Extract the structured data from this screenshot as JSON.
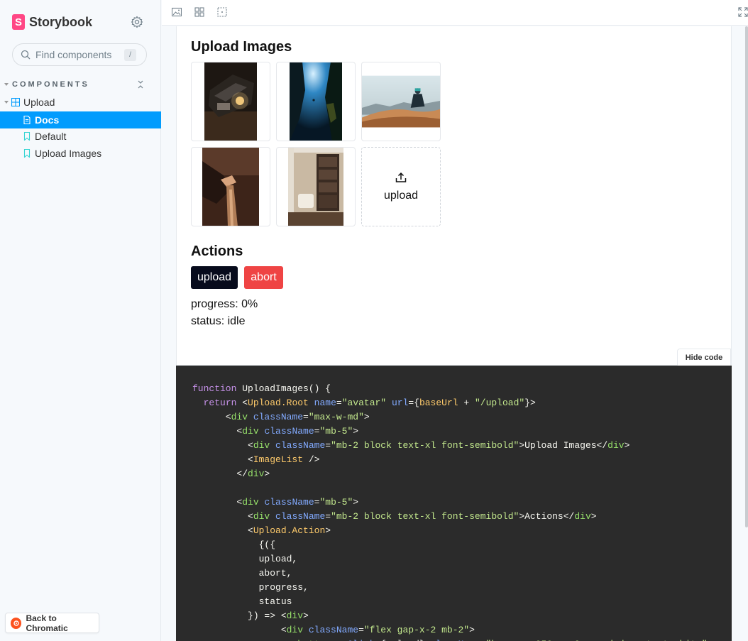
{
  "sidebar": {
    "brand": "Storybook",
    "logo_letter": "S",
    "search_placeholder": "Find components",
    "search_shortcut": "/",
    "section": "COMPONENTS",
    "tree": [
      {
        "label": "Upload",
        "type": "component"
      },
      {
        "label": "Docs",
        "type": "docs",
        "active": true
      },
      {
        "label": "Default",
        "type": "story"
      },
      {
        "label": "Upload Images",
        "type": "story"
      }
    ],
    "back_label": "Back to Chromatic"
  },
  "toolbar": {
    "icons": [
      "image-icon",
      "grid-icon",
      "outline-icon"
    ],
    "fullscreen_icon": "fullscreen-icon"
  },
  "story": {
    "images_title": "Upload Images",
    "upload_tile_label": "upload",
    "actions_title": "Actions",
    "upload_button": "upload",
    "abort_button": "abort",
    "progress_text": "progress: 0%",
    "status_text": "status: idle",
    "hide_code": "Hide code"
  },
  "colors": {
    "accent": "#029cfd",
    "brand": "#ff4785",
    "abort": "#ef4444",
    "upload": "#070b1c",
    "code_bg": "#2b2b2b"
  }
}
